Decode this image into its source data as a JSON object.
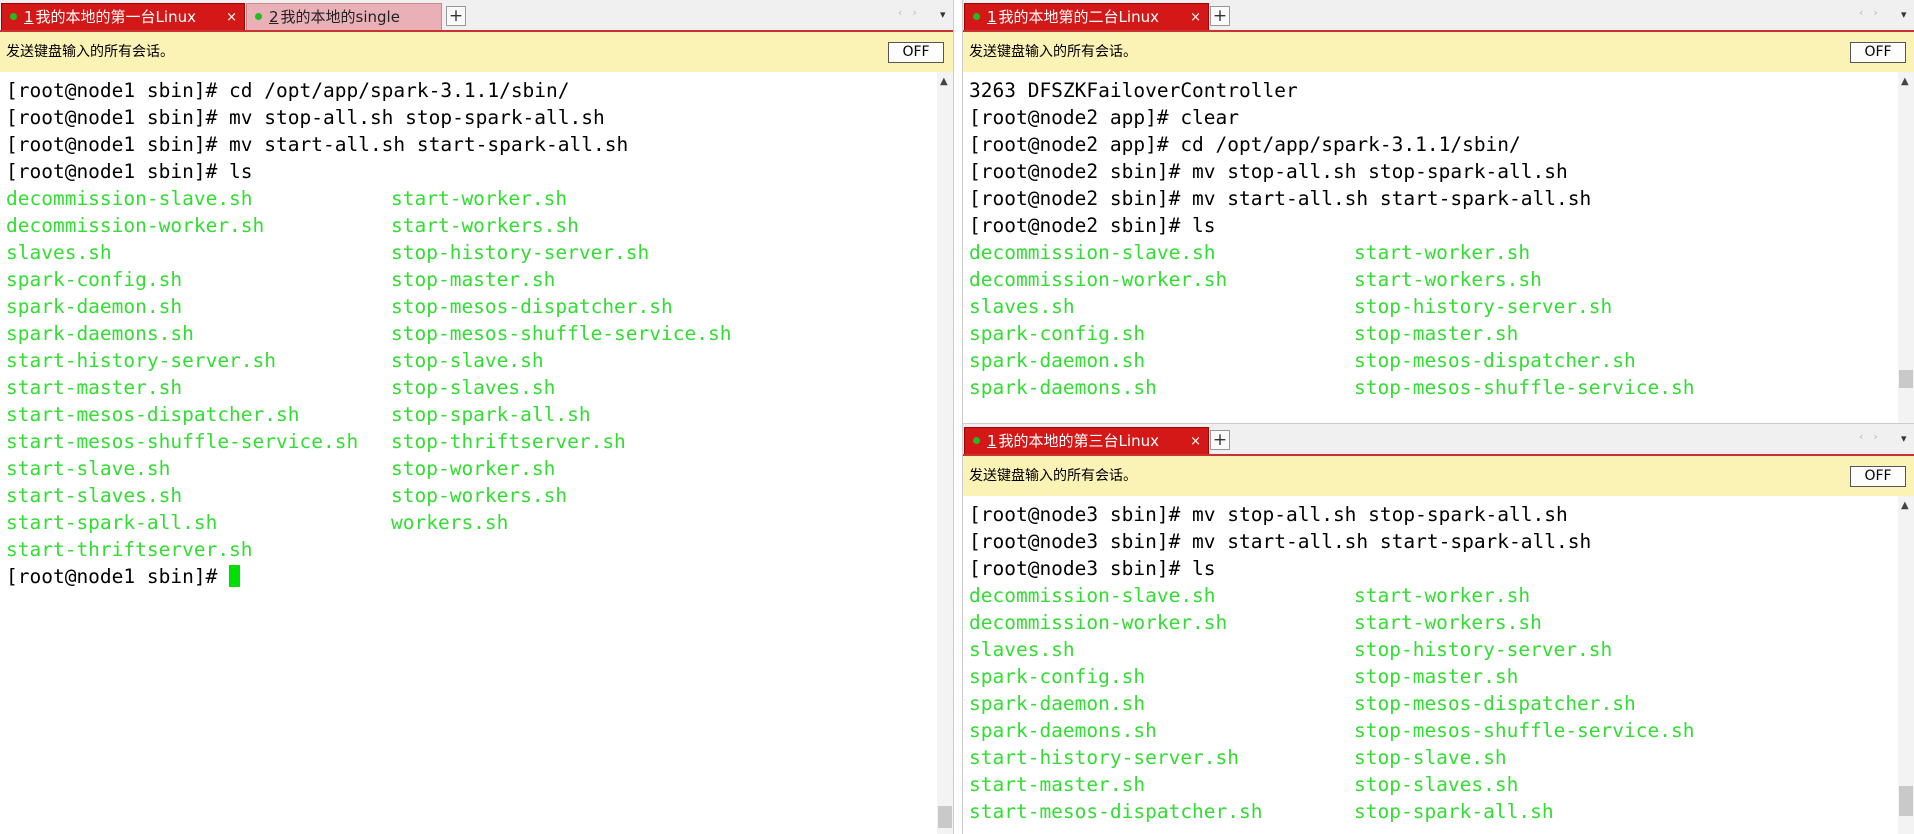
{
  "left": {
    "tabs": [
      {
        "num": "1",
        "label": "我的本地的第一台Linux",
        "close": "×"
      },
      {
        "num": "2",
        "label": "我的本地的single"
      }
    ],
    "add_label": "+",
    "nav_arrows": "‹›",
    "nav_menu": "▾",
    "broadcast": "发送键盘输入的所有会话。",
    "off": "OFF",
    "lines": [
      "[root@node1 sbin]# cd /opt/app/spark-3.1.1/sbin/",
      "[root@node1 sbin]# mv stop-all.sh stop-spark-all.sh",
      "[root@node1 sbin]# mv start-all.sh start-spark-all.sh",
      "[root@node1 sbin]# ls"
    ],
    "ls_rows": [
      [
        "decommission-slave.sh",
        "start-worker.sh"
      ],
      [
        "decommission-worker.sh",
        "start-workers.sh"
      ],
      [
        "slaves.sh",
        "stop-history-server.sh"
      ],
      [
        "spark-config.sh",
        "stop-master.sh"
      ],
      [
        "spark-daemon.sh",
        "stop-mesos-dispatcher.sh"
      ],
      [
        "spark-daemons.sh",
        "stop-mesos-shuffle-service.sh"
      ],
      [
        "start-history-server.sh",
        "stop-slave.sh"
      ],
      [
        "start-master.sh",
        "stop-slaves.sh"
      ],
      [
        "start-mesos-dispatcher.sh",
        "stop-spark-all.sh"
      ],
      [
        "start-mesos-shuffle-service.sh",
        "stop-thriftserver.sh"
      ],
      [
        "start-slave.sh",
        "stop-worker.sh"
      ],
      [
        "start-slaves.sh",
        "stop-workers.sh"
      ],
      [
        "start-spark-all.sh",
        "workers.sh"
      ],
      [
        "start-thriftserver.sh",
        ""
      ]
    ],
    "prompt": "[root@node1 sbin]# "
  },
  "top_right": {
    "tab": {
      "num": "1",
      "label": "我的本地第的二台Linux",
      "close": "×"
    },
    "add_label": "+",
    "nav_arrows": "‹›",
    "nav_menu": "▾",
    "broadcast": "发送键盘输入的所有会话。",
    "off": "OFF",
    "lines": [
      "3263 DFSZKFailoverController",
      "[root@node2 app]# clear",
      "[root@node2 app]# cd /opt/app/spark-3.1.1/sbin/",
      "[root@node2 sbin]# mv stop-all.sh stop-spark-all.sh",
      "[root@node2 sbin]# mv start-all.sh start-spark-all.sh",
      "[root@node2 sbin]# ls"
    ],
    "ls_rows": [
      [
        "decommission-slave.sh",
        "start-worker.sh"
      ],
      [
        "decommission-worker.sh",
        "start-workers.sh"
      ],
      [
        "slaves.sh",
        "stop-history-server.sh"
      ],
      [
        "spark-config.sh",
        "stop-master.sh"
      ],
      [
        "spark-daemon.sh",
        "stop-mesos-dispatcher.sh"
      ],
      [
        "spark-daemons.sh",
        "stop-mesos-shuffle-service.sh"
      ]
    ]
  },
  "bottom_right": {
    "tab": {
      "num": "1",
      "label": "我的本地的第三台Linux",
      "close": "×"
    },
    "add_label": "+",
    "nav_arrows": "‹›",
    "nav_menu": "▾",
    "broadcast": "发送键盘输入的所有会话。",
    "off": "OFF",
    "lines": [
      "[root@node3 sbin]# mv stop-all.sh stop-spark-all.sh",
      "[root@node3 sbin]# mv start-all.sh start-spark-all.sh",
      "[root@node3 sbin]# ls"
    ],
    "ls_rows": [
      [
        "decommission-slave.sh",
        "start-worker.sh"
      ],
      [
        "decommission-worker.sh",
        "start-workers.sh"
      ],
      [
        "slaves.sh",
        "stop-history-server.sh"
      ],
      [
        "spark-config.sh",
        "stop-master.sh"
      ],
      [
        "spark-daemon.sh",
        "stop-mesos-dispatcher.sh"
      ],
      [
        "spark-daemons.sh",
        "stop-mesos-shuffle-service.sh"
      ],
      [
        "start-history-server.sh",
        "stop-slave.sh"
      ],
      [
        "start-master.sh",
        "stop-slaves.sh"
      ],
      [
        "start-mesos-dispatcher.sh",
        "stop-spark-all.sh"
      ]
    ]
  },
  "colors": {
    "tab_active": "#d41818",
    "broadcast_bg": "#fbf2b5",
    "ls_green": "#33dd33",
    "cursor": "#00e000"
  }
}
